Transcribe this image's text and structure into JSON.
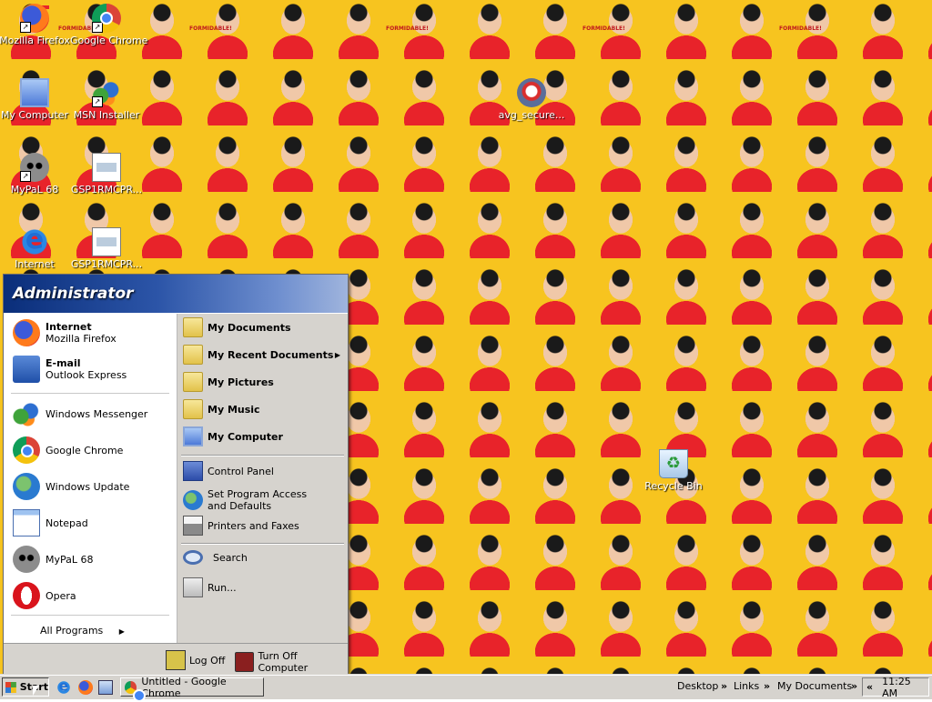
{
  "desktop": {
    "wallpaper_text": "FORMIDABLE!",
    "icons": [
      {
        "label": "Mozilla Firefox",
        "icon": "firefox-icon"
      },
      {
        "label": "Google Chrome",
        "icon": "chrome-icon"
      },
      {
        "label": "My Computer",
        "icon": "my-computer-icon"
      },
      {
        "label": "MSN Installer",
        "icon": "msn-icon"
      },
      {
        "label": "avg_secure...",
        "icon": "avg-icon"
      },
      {
        "label": "MyPaL 68",
        "icon": "mypal-icon"
      },
      {
        "label": "GSP1RMCPR...",
        "icon": "document-icon"
      },
      {
        "label": "Internet",
        "icon": "internet-explorer-icon"
      },
      {
        "label": "GSP1RMCPR...",
        "icon": "document-icon"
      },
      {
        "label": "Recycle Bin",
        "icon": "recycle-bin-icon"
      }
    ]
  },
  "start_menu": {
    "user": "Administrator",
    "pinned": [
      {
        "title": "Internet",
        "subtitle": "Mozilla Firefox"
      },
      {
        "title": "E-mail",
        "subtitle": "Outlook Express"
      }
    ],
    "recent": [
      {
        "label": "Windows Messenger"
      },
      {
        "label": "Google Chrome"
      },
      {
        "label": "Windows Update"
      },
      {
        "label": "Notepad"
      },
      {
        "label": "MyPaL 68"
      },
      {
        "label": "Opera"
      }
    ],
    "all_programs": "All Programs",
    "right": {
      "my_documents": "My Documents",
      "my_recent_documents": "My Recent Documents",
      "my_pictures": "My Pictures",
      "my_music": "My Music",
      "my_computer": "My Computer",
      "control_panel": "Control Panel",
      "set_program_access": "Set Program Access and Defaults",
      "printers_faxes": "Printers and Faxes",
      "search": "Search",
      "run": "Run..."
    },
    "log_off": "Log Off",
    "turn_off": "Turn Off Computer"
  },
  "taskbar": {
    "start": "Start",
    "task": "Untitled - Google Chrome",
    "toolbars": [
      "Desktop",
      "Links",
      "My Documents"
    ],
    "chevron": "»",
    "clock": "11:25 AM",
    "tray_chevron": "«"
  },
  "colors": {
    "wallpaper": "#f7c41f",
    "shirt": "#e8232a",
    "menu_header": "#2c55a8",
    "taskbar": "#d6d3ce"
  }
}
